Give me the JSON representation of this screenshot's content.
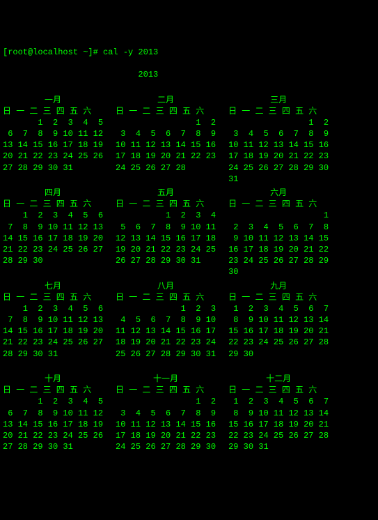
{
  "prompt": "[root@localhost ~]# cal -y 2013",
  "year_title": "                           2013",
  "weekday_labels": [
    "日",
    "一",
    "二",
    "三",
    "四",
    "五",
    "六"
  ],
  "months": [
    {
      "name": "一月",
      "first_wd": 2,
      "days": 31
    },
    {
      "name": "二月",
      "first_wd": 5,
      "days": 28
    },
    {
      "name": "三月",
      "first_wd": 5,
      "days": 31
    },
    {
      "name": "四月",
      "first_wd": 1,
      "days": 30
    },
    {
      "name": "五月",
      "first_wd": 3,
      "days": 31
    },
    {
      "name": "六月",
      "first_wd": 6,
      "days": 30
    },
    {
      "name": "七月",
      "first_wd": 1,
      "days": 31
    },
    {
      "name": "八月",
      "first_wd": 4,
      "days": 31
    },
    {
      "name": "九月",
      "first_wd": 0,
      "days": 30
    },
    {
      "name": "十月",
      "first_wd": 2,
      "days": 31
    },
    {
      "name": "十一月",
      "first_wd": 5,
      "days": 30
    },
    {
      "name": "十二月",
      "first_wd": 0,
      "days": 31
    }
  ],
  "chart_data": {
    "type": "table",
    "title": "2013",
    "note": "Output of cal -y 2013; calendar year grid, Sunday-first weeks"
  }
}
